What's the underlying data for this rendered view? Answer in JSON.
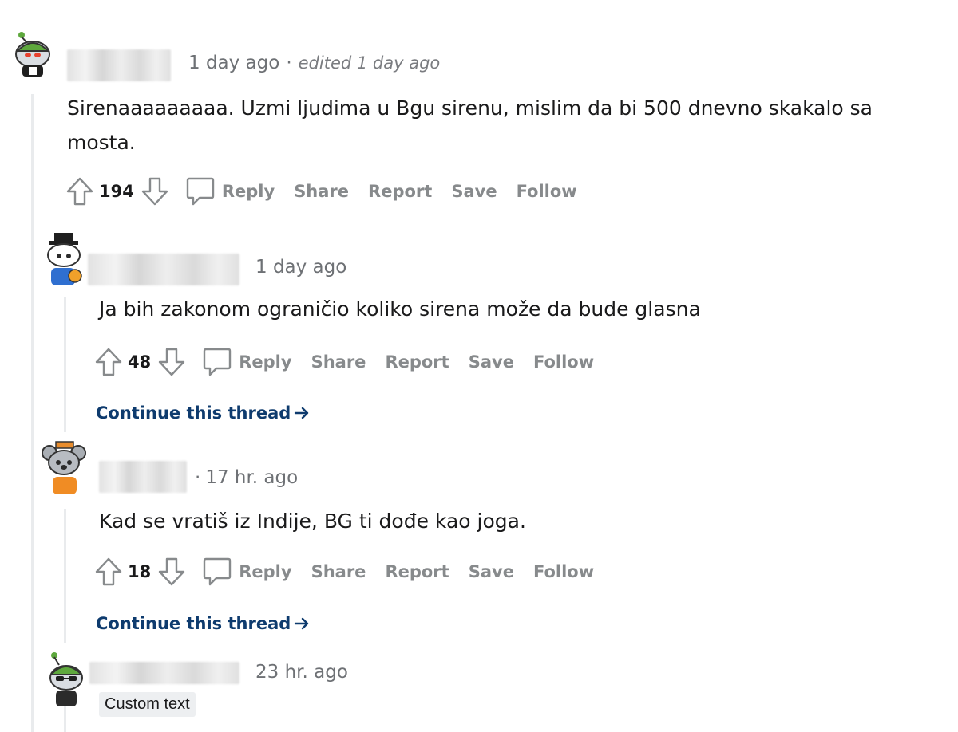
{
  "comments": [
    {
      "time": "1 day ago",
      "edited": "edited 1 day ago",
      "avatar_icon": "snoo-green-hat-avatar-icon",
      "text": "Sirenaaaaaaaaa. Uzmi ljudima u Bgu sirenu, mislim da bi 500 dnevno skakalo sa mosta.",
      "score": "194"
    },
    {
      "time": "1 day ago",
      "avatar_icon": "snoo-top-hat-avatar-icon",
      "text": "Ja bih zakonom ograničio koliko sirena može da bude glasna",
      "score": "48",
      "continue": "Continue this thread"
    },
    {
      "time": "17 hr. ago",
      "avatar_icon": "snoo-koala-avatar-icon",
      "text": "Kad se vratiš iz Indije, BG ti dođe kao joga.",
      "score": "18",
      "continue": "Continue this thread"
    },
    {
      "time": "23 hr. ago",
      "avatar_icon": "snoo-green-sunglasses-avatar-icon",
      "flair": "Custom text"
    }
  ],
  "actions": {
    "reply": "Reply",
    "share": "Share",
    "report": "Report",
    "save": "Save",
    "follow": "Follow"
  },
  "colors": {
    "muted": "#878a8c",
    "link": "#0e3b6e",
    "thread_line": "#e9ebed"
  }
}
